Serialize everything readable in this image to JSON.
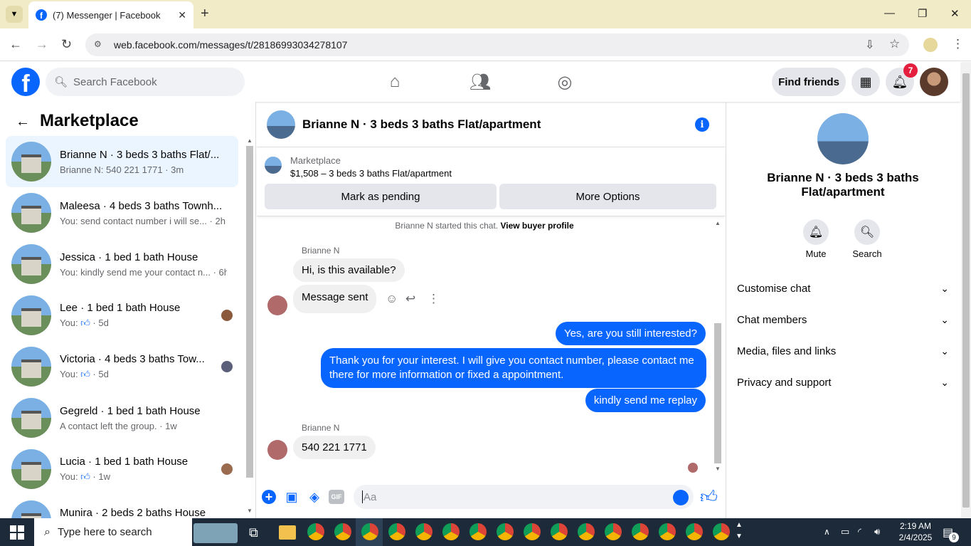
{
  "browser": {
    "tab_title": "(7) Messenger | Facebook",
    "url": "web.facebook.com/messages/t/28186993034278107"
  },
  "header": {
    "search_placeholder": "Search Facebook",
    "find_friends": "Find friends",
    "notif_count": "7"
  },
  "sidebar": {
    "title": "Marketplace",
    "conversations": [
      {
        "name": "Brianne N · 3 beds 3 baths Flat/...",
        "sub": "Brianne N: 540 221 1771 · 3m"
      },
      {
        "name": "Maleesa · 4 beds 3 baths Townh...",
        "sub": "You: send contact number i will se... · 2h"
      },
      {
        "name": "Jessica · 1 bed 1 bath House",
        "sub": "You: kindly send me your contact n... · 6h"
      },
      {
        "name": "Lee · 1 bed 1 bath House",
        "sub_prefix": "You:",
        "sub_suffix": "· 5d"
      },
      {
        "name": "Victoria · 4 beds 3 baths Tow...",
        "sub_prefix": "You:",
        "sub_suffix": "· 5d"
      },
      {
        "name": "Gegreld · 1 bed 1 bath House",
        "sub": "A contact left the group. · 1w"
      },
      {
        "name": "Lucia · 1 bed 1 bath House",
        "sub_prefix": "You:",
        "sub_suffix": "· 1w"
      },
      {
        "name": "Munira · 2 beds 2 baths House",
        "sub": ""
      }
    ]
  },
  "chat": {
    "title": "Brianne N · 3 beds 3 baths Flat/apartment",
    "listing_label": "Marketplace",
    "listing_price": "$1,508 – 3 beds 3 baths Flat/apartment",
    "mark_pending": "Mark as pending",
    "more_options": "More Options",
    "system_text": "Brianne N started this chat.",
    "view_buyer": "View buyer profile",
    "sender": "Brianne N",
    "msg_in_1": "Hi, is this available?",
    "msg_in_2": "Message sent",
    "msg_out_1": "Yes, are you still interested?",
    "msg_out_2": "Thank you for your interest. I will give you  contact number, please contact me there for more information or fixed a appointment.",
    "msg_out_3": "kindly send me replay",
    "msg_in_3": "540 221 1771",
    "input_placeholder": "Aa"
  },
  "details": {
    "name": "Brianne N · 3 beds 3 baths Flat/apartment",
    "mute": "Mute",
    "search": "Search",
    "sections": [
      "Customise chat",
      "Chat members",
      "Media, files and links",
      "Privacy and support"
    ]
  },
  "taskbar": {
    "search_placeholder": "Type here to search",
    "time": "2:19 AM",
    "date": "2/4/2025",
    "notif_count": "9"
  },
  "colors": {
    "brand": "#0866ff",
    "badge": "#e41e3f"
  }
}
